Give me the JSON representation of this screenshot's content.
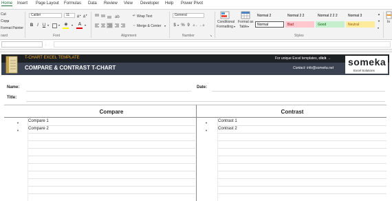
{
  "ribbon_tabs": [
    "Home",
    "Insert",
    "Page Layout",
    "Formulas",
    "Data",
    "Review",
    "View",
    "Developer",
    "Help",
    "Power Pivot"
  ],
  "clipboard": {
    "cut": "Cut",
    "copy": "Copy",
    "format_painter": "Format Painter",
    "label": "oard"
  },
  "font": {
    "family": "Calibri",
    "size": "11",
    "label": "Font",
    "bold": "B",
    "italic": "I",
    "underline": "U"
  },
  "alignment": {
    "wrap_text": "Wrap Text",
    "merge_center": "Merge & Center",
    "label": "Alignment"
  },
  "number": {
    "format": "General",
    "label": "Number",
    "currency": "$",
    "percent": "%",
    "comma": "9"
  },
  "styles": {
    "label": "Styles",
    "conditional_formatting": [
      "Conditional",
      "Formatting"
    ],
    "format_as_table": [
      "Format as",
      "Table"
    ],
    "items": [
      {
        "name": "Normal 2",
        "bg": "",
        "color": "#222222"
      },
      {
        "name": "Normal 2 2",
        "bg": "",
        "color": "#222222"
      },
      {
        "name": "Normal 2 2 2",
        "bg": "",
        "color": "#222222"
      },
      {
        "name": "Normal 3",
        "bg": "",
        "color": "#222222"
      },
      {
        "name": "Normal",
        "bg": "#ffffff",
        "color": "#222222"
      },
      {
        "name": "Bad",
        "bg": "#ffc7ce",
        "color": "#9c0006"
      },
      {
        "name": "Good",
        "bg": "#c6efce",
        "color": "#006100"
      },
      {
        "name": "Neutral",
        "bg": "#ffeb9c",
        "color": "#9c5700"
      }
    ],
    "insert_truncated": "In"
  },
  "banner": {
    "template_label": "T-CHART EXCEL TEMPLATE",
    "title": "COMPARE & CONTRAST T-CHART",
    "promo_prefix": "For unique Excel templates, ",
    "promo_link": "click →",
    "contact": "Contact: info@someka.net",
    "logo": "someka",
    "logo_sub": "Excel Solutions"
  },
  "form": {
    "name_label": "Name:",
    "date_label": "Date:",
    "title_label": "Title:"
  },
  "tchart": {
    "left_header": "Compare",
    "right_header": "Contrast",
    "left_items": [
      "Compare 1",
      "Compare 2"
    ],
    "right_items": [
      "Contrast 1",
      "Contrast 2"
    ]
  },
  "colors": {
    "accent": "#1e6e3c",
    "banner_dark": "#1e2124",
    "banner_mid": "#3b4252",
    "banner_text": "#f0a830"
  }
}
